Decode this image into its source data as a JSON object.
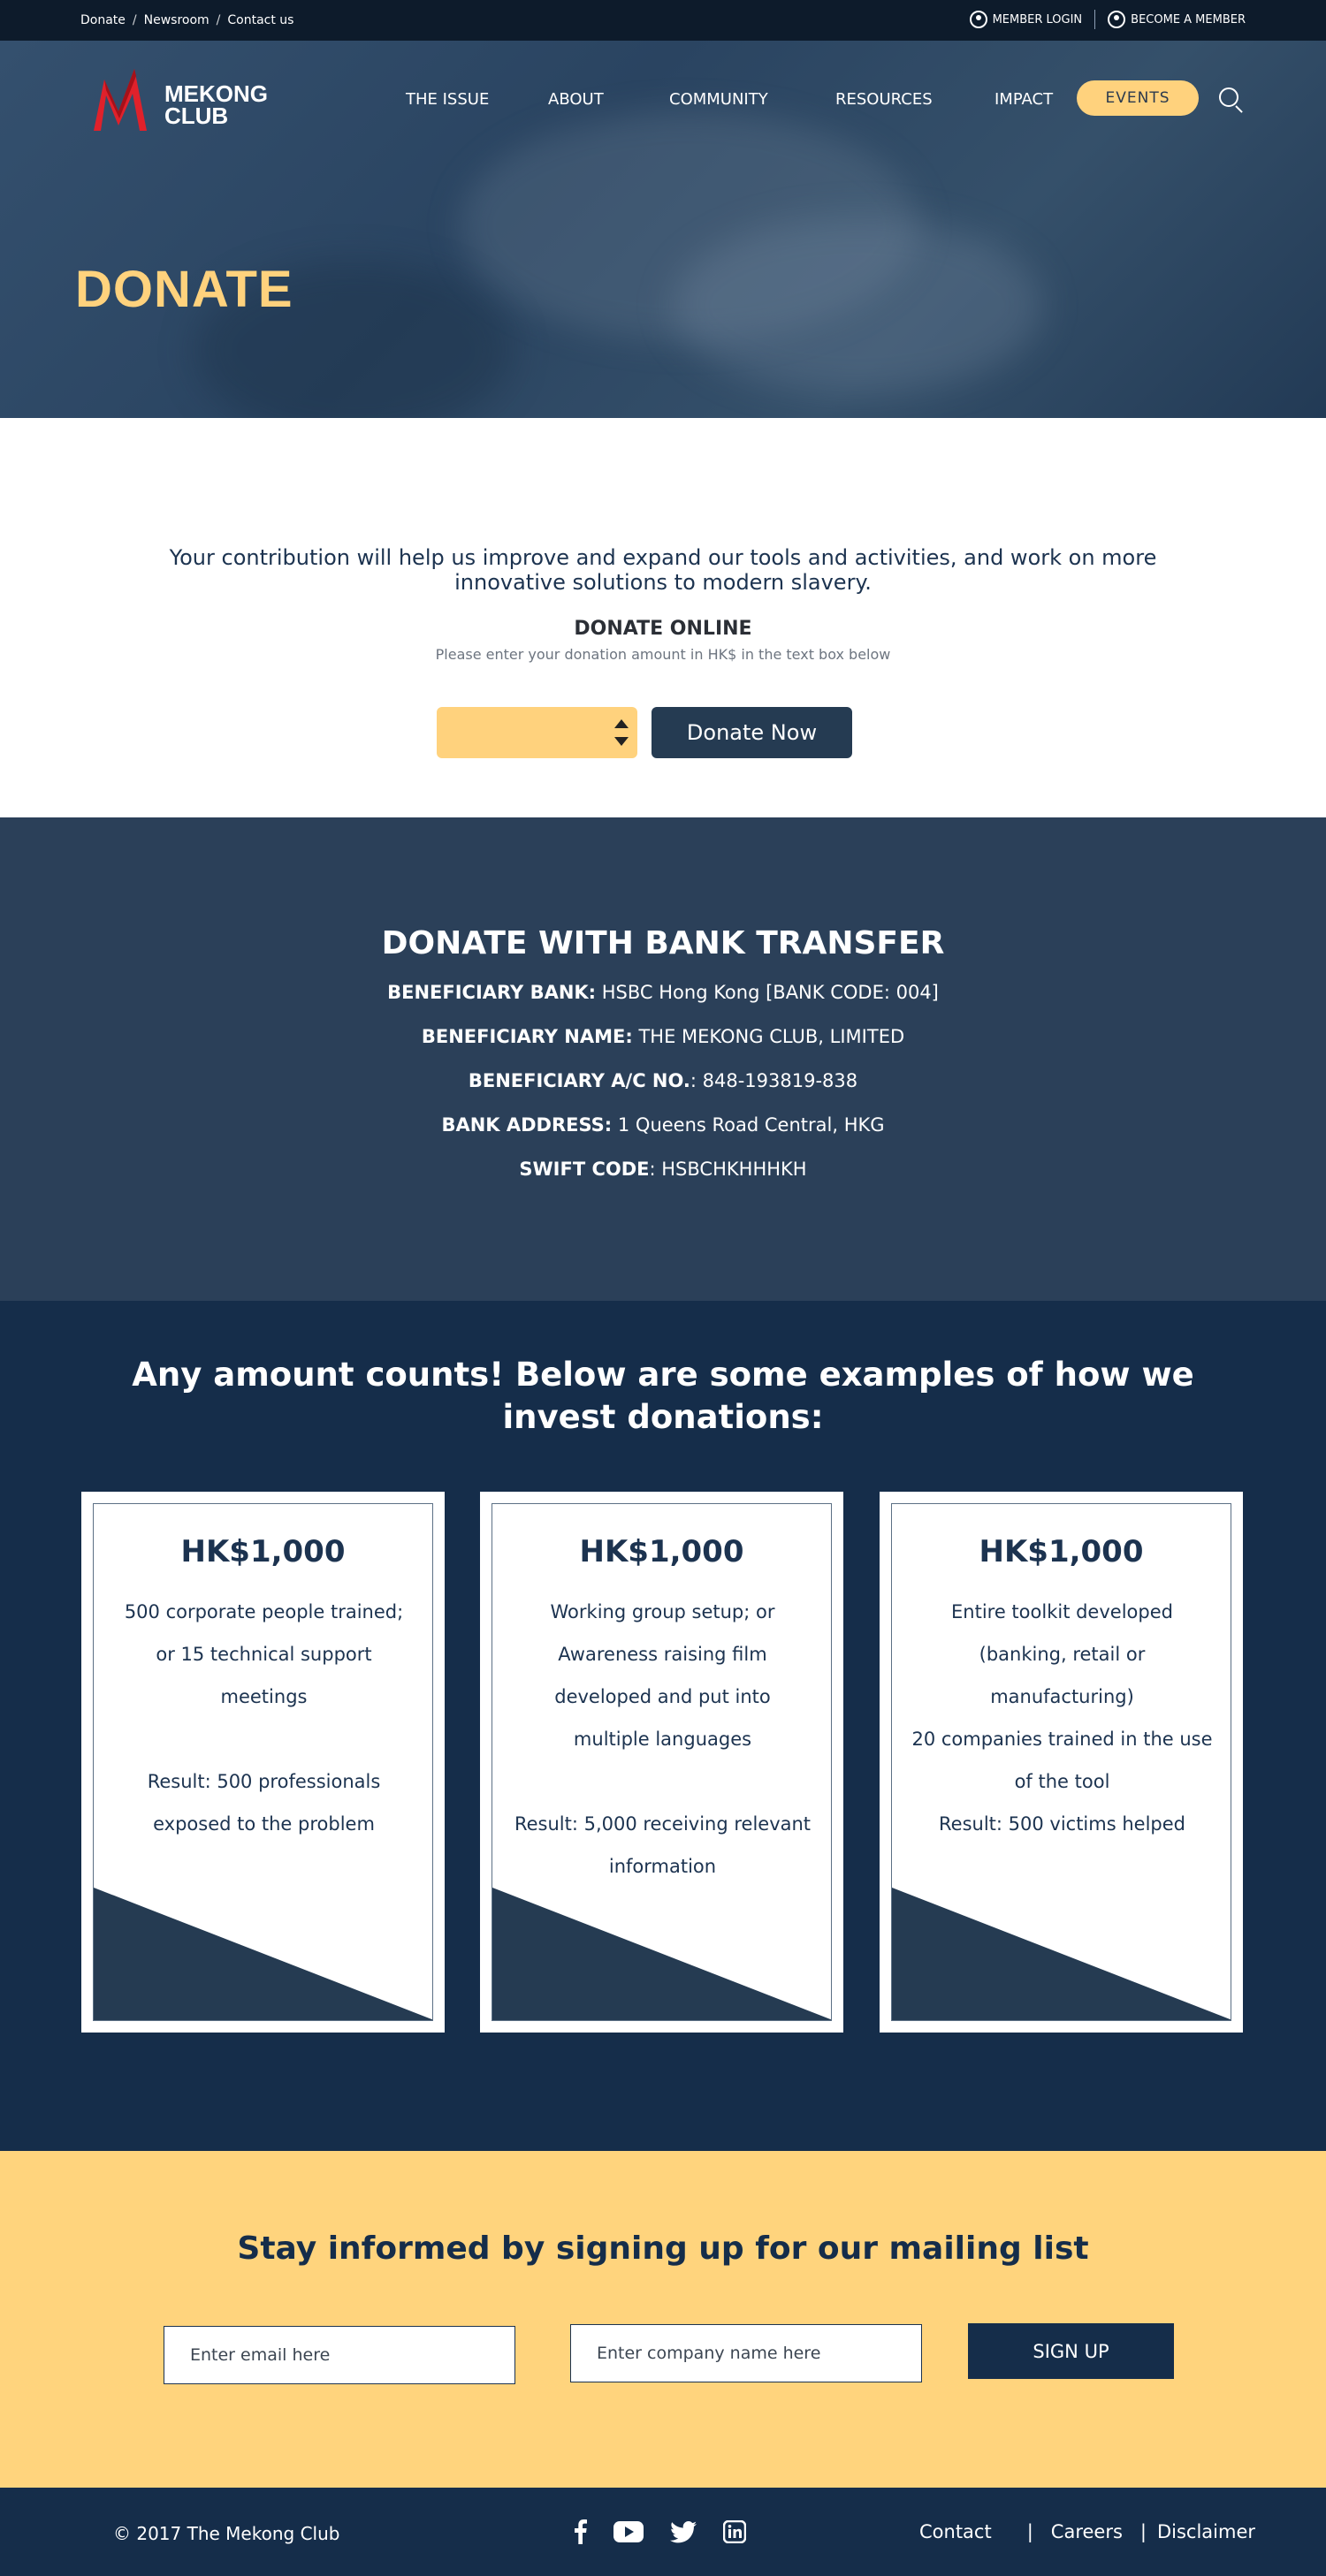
{
  "topbar": {
    "links": [
      "Donate",
      "Newsroom",
      "Contact us"
    ],
    "separator": "/",
    "member_login": "MEMBER  LOGIN",
    "become_member": "BECOME A MEMBER"
  },
  "header": {
    "logo_line1": "MEKONG",
    "logo_line2": "CLUB",
    "nav": [
      "THE ISSUE",
      "ABOUT",
      "COMMUNITY",
      "RESOURCES",
      "IMPACT"
    ],
    "events_label": "EVENTS",
    "search_icon": "search-icon"
  },
  "hero": {
    "title": "DONATE"
  },
  "donate_online": {
    "lead": "Your contribution will help us improve and expand our tools and activities, and work on more innovative solutions to modern slavery.",
    "heading": "DONATE ONLINE",
    "subtext": "Please enter your donation amount in HK$ in the text box below",
    "button_label": "Donate Now"
  },
  "bank": {
    "title": "DONATE WITH BANK TRANSFER",
    "rows": [
      {
        "label": "BENEFICIARY BANK:",
        "value": " HSBC Hong Kong [BANK CODE: 004]"
      },
      {
        "label": "BENEFICIARY NAME:",
        "value": " THE MEKONG CLUB, LIMITED"
      },
      {
        "label": "BENEFICIARY A/C NO.",
        "value": ": 848-193819-838"
      },
      {
        "label": "BANK ADDRESS:",
        "value": " 1 Queens Road Central, HKG"
      },
      {
        "label": "SWIFT CODE",
        "value": ": HSBCHKHHHKH"
      }
    ]
  },
  "examples": {
    "title": "Any amount counts! Below are some examples of how we invest donations:",
    "cards": [
      {
        "amount": "HK$1,000",
        "lines": [
          "500 corporate people trained;",
          "or 15 technical support",
          "meetings",
          "",
          "Result: 500 professionals",
          "exposed to the problem"
        ]
      },
      {
        "amount": "HK$1,000",
        "lines": [
          "Working group setup; or",
          "Awareness raising film",
          "developed and put into",
          "multiple languages",
          "",
          "Result: 5,000 receiving relevant",
          "information"
        ]
      },
      {
        "amount": "HK$1,000",
        "lines": [
          "Entire toolkit developed",
          "(banking, retail or",
          "manufacturing)",
          "20 companies trained in the use",
          "of the tool",
          "Result: 500 victims helped"
        ]
      }
    ]
  },
  "mailing": {
    "title": "Stay informed by signing up for our mailing list",
    "email_placeholder": "Enter email here",
    "company_placeholder": "Enter  company name here",
    "button_label": "SIGN UP"
  },
  "footer": {
    "copyright": "© 2017 The Mekong Club",
    "social": [
      "facebook-icon",
      "youtube-icon",
      "twitter-icon",
      "linkedin-icon"
    ],
    "links": [
      "Contact",
      "Careers",
      "Disclaimer"
    ],
    "separator": "|"
  },
  "colors": {
    "navy": "#152d4a",
    "slate": "#2b4059",
    "accent_yellow": "#ffd27d",
    "logo_red": "#e0212b"
  }
}
